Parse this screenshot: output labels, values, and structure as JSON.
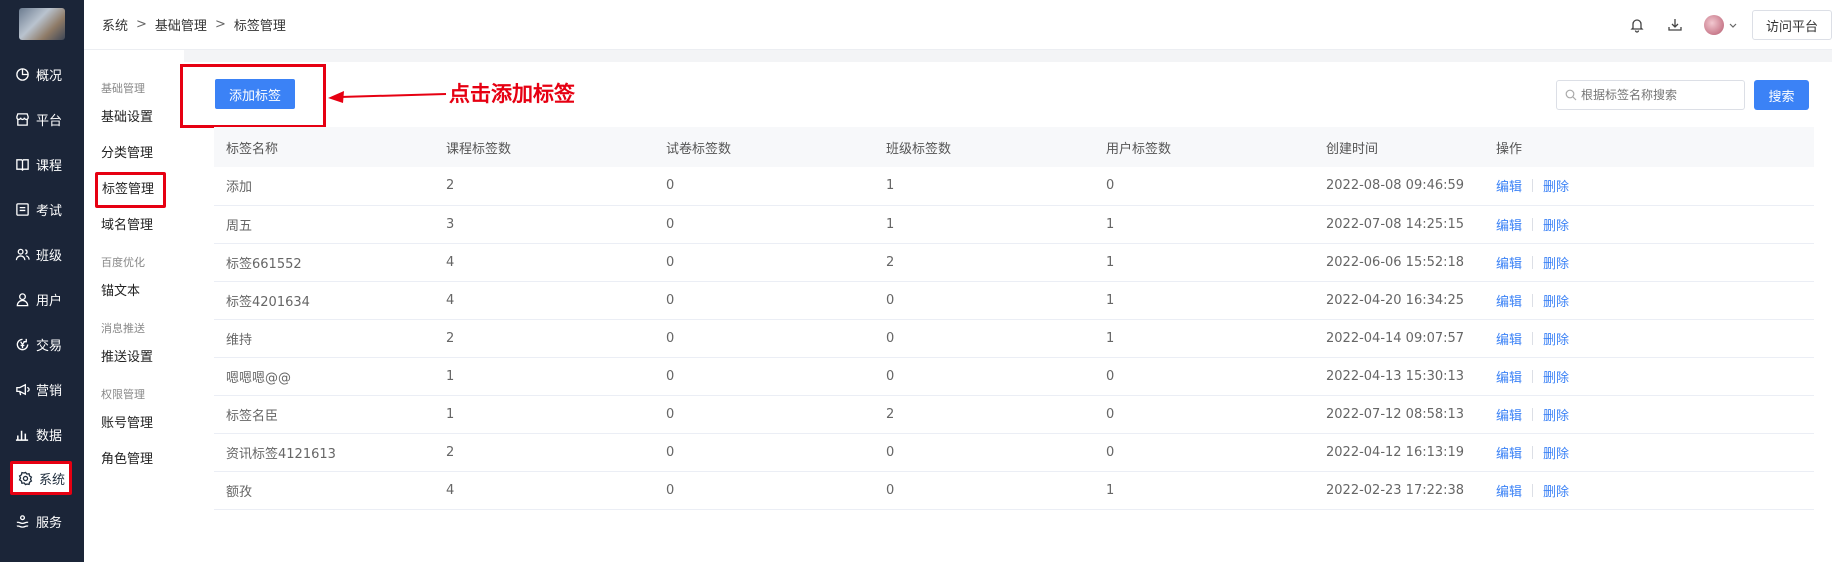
{
  "nav": {
    "items": [
      {
        "label": "概况",
        "icon": "clock-pie-icon"
      },
      {
        "label": "平台",
        "icon": "store-icon"
      },
      {
        "label": "课程",
        "icon": "book-icon"
      },
      {
        "label": "考试",
        "icon": "exam-icon"
      },
      {
        "label": "班级",
        "icon": "group-icon"
      },
      {
        "label": "用户",
        "icon": "user-icon"
      },
      {
        "label": "交易",
        "icon": "yen-circle-icon"
      },
      {
        "label": "营销",
        "icon": "megaphone-icon"
      },
      {
        "label": "数据",
        "icon": "bar-chart-icon"
      },
      {
        "label": "系统",
        "icon": "gear-icon"
      },
      {
        "label": "服务",
        "icon": "service-icon"
      }
    ]
  },
  "breadcrumb": [
    "系统",
    "基础管理",
    "标签管理"
  ],
  "topbar": {
    "visit_label": "访问平台"
  },
  "submenu": {
    "groups": [
      {
        "title": "基础管理",
        "items": [
          "基础设置",
          "分类管理",
          "标签管理",
          "域名管理"
        ]
      },
      {
        "title": "百度优化",
        "items": [
          "锚文本"
        ]
      },
      {
        "title": "消息推送",
        "items": [
          "推送设置"
        ]
      },
      {
        "title": "权限管理",
        "items": [
          "账号管理",
          "角色管理"
        ]
      }
    ]
  },
  "toolbar": {
    "add_label": "添加标签",
    "annotation": "点击添加标签",
    "search_placeholder": "根据标签名称搜索",
    "search_label": "搜索"
  },
  "table": {
    "columns": [
      "标签名称",
      "课程标签数",
      "试卷标签数",
      "班级标签数",
      "用户标签数",
      "创建时间",
      "操作"
    ],
    "rows": [
      [
        "添加",
        "2",
        "0",
        "1",
        "0",
        "2022-08-08 09:46:59"
      ],
      [
        "周五",
        "3",
        "0",
        "1",
        "1",
        "2022-07-08 14:25:15"
      ],
      [
        "标签661552",
        "4",
        "0",
        "2",
        "1",
        "2022-06-06 15:52:18"
      ],
      [
        "标签4201634",
        "4",
        "0",
        "0",
        "1",
        "2022-04-20 16:34:25"
      ],
      [
        "维持",
        "2",
        "0",
        "0",
        "1",
        "2022-04-14 09:07:57"
      ],
      [
        "嗯嗯嗯@@",
        "1",
        "0",
        "0",
        "0",
        "2022-04-13 15:30:13"
      ],
      [
        "标签名臣",
        "1",
        "0",
        "2",
        "0",
        "2022-07-12 08:58:13"
      ],
      [
        "资讯标签4121613",
        "2",
        "0",
        "0",
        "0",
        "2022-04-12 16:13:19"
      ],
      [
        "额孜",
        "4",
        "0",
        "0",
        "1",
        "2022-02-23 17:22:38"
      ]
    ],
    "edit_label": "编辑",
    "delete_label": "删除"
  },
  "colors": {
    "primary": "#3b82f6",
    "nav_bg": "#1b2538",
    "highlight": "#e60012"
  }
}
